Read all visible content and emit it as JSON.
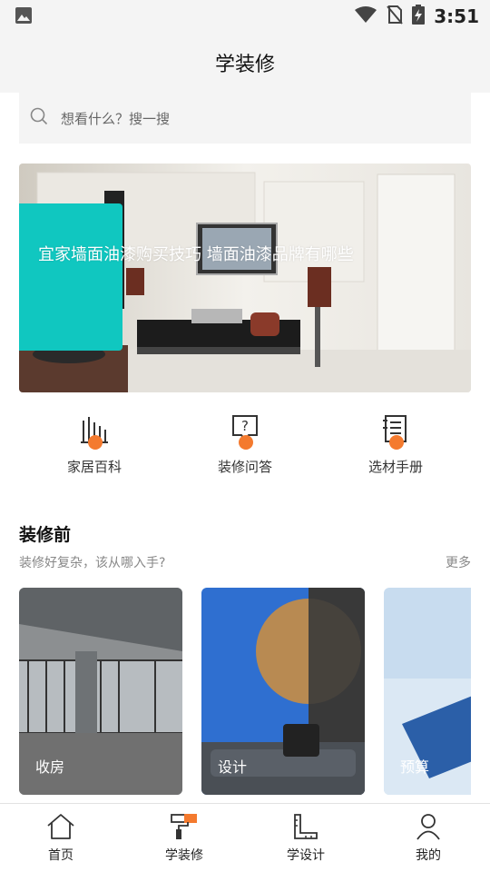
{
  "status_bar": {
    "time": "3:51",
    "icons": [
      "image-icon",
      "wifi-icon",
      "no-sim-icon",
      "battery-charging-icon"
    ]
  },
  "header": {
    "title": "学装修"
  },
  "search": {
    "placeholder": "想看什么？搜一搜",
    "icon": "search-icon"
  },
  "banner": {
    "caption": "宜家墙面油漆购买技巧 墙面油漆品牌有哪些",
    "accent_color": "#10c7c0"
  },
  "quick_links": [
    {
      "label": "家居百科",
      "icon": "encyclopedia-icon"
    },
    {
      "label": "装修问答",
      "icon": "question-icon"
    },
    {
      "label": "选材手册",
      "icon": "handbook-icon"
    }
  ],
  "section": {
    "title": "装修前",
    "subtitle": "装修好复杂，该从哪入手?",
    "more": "更多"
  },
  "cards": [
    {
      "label": "收房"
    },
    {
      "label": "设计"
    },
    {
      "label": "预算"
    }
  ],
  "bottom_nav": [
    {
      "label": "首页",
      "icon": "home-icon"
    },
    {
      "label": "学装修",
      "icon": "paint-roller-icon",
      "active": true
    },
    {
      "label": "学设计",
      "icon": "ruler-icon"
    },
    {
      "label": "我的",
      "icon": "profile-icon"
    }
  ],
  "colors": {
    "accent_orange": "#f47a2e",
    "teal": "#10c7c0",
    "header_bg": "#f4f4f4"
  }
}
